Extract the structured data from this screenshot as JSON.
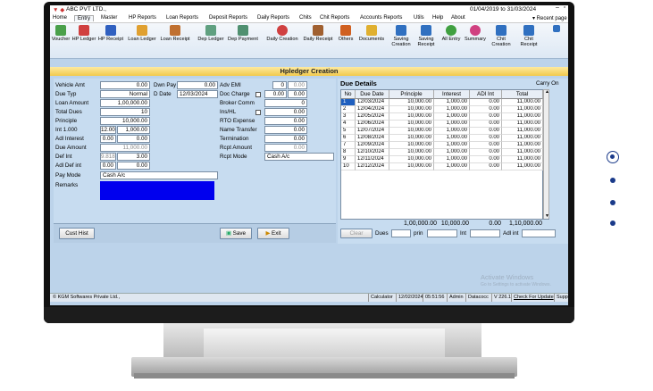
{
  "titlebar": {
    "app": "ABC PVT LTD.,",
    "period": "01/04/2019 to 31/03/2024"
  },
  "menu": [
    "Home",
    "Entry",
    "Master",
    "HP Reports",
    "Loan Reports",
    "Deposit Reports",
    "Daily Reports",
    "Chits",
    "Chit Reports",
    "Accounts Reports",
    "Utils",
    "Help",
    "About"
  ],
  "menu_right": "▾ Recent page",
  "ribbon": [
    {
      "label": "Voucher",
      "color": "#4aa04a"
    },
    {
      "label": "HP Ledger",
      "color": "#d04040"
    },
    {
      "label": "HP Receipt",
      "color": "#3060c0"
    },
    {
      "label": "Loan Ledger",
      "color": "#e0a030"
    },
    {
      "label": "Loan Receipt",
      "color": "#c07030"
    },
    {
      "label": "Dep Ledger",
      "color": "#60a080"
    },
    {
      "label": "Dep Payment",
      "color": "#509070"
    },
    {
      "label": "Daily Creation",
      "color": "#d04040"
    },
    {
      "label": "Daily Receipt",
      "color": "#a06030"
    },
    {
      "label": "Others",
      "color": "#d06020"
    },
    {
      "label": "Documents",
      "color": "#e0b030"
    },
    {
      "label": "Saving Creation",
      "color": "#3070c0"
    },
    {
      "label": "Saving Receipt",
      "color": "#3070c0"
    },
    {
      "label": "All Entry",
      "color": "#40a040"
    },
    {
      "label": "Summary",
      "color": "#d04080"
    },
    {
      "label": "Chit Creation",
      "color": "#3070c0"
    },
    {
      "label": "Chit Receipt",
      "color": "#3070c0"
    }
  ],
  "window_title": "Hpledger Creation",
  "form": {
    "vehicle_amt_label": "Vehicle Amt",
    "vehicle_amt": "0.00",
    "dwn_pay_label": "Dwn Pay",
    "dwn_pay": "0.00",
    "adv_emi_label": "Adv EMI",
    "adv_emi_n": "0",
    "adv_emi": "0.00",
    "due_typ_label": "Due Typ",
    "due_typ": "Normal",
    "d_date_label": "D Date",
    "d_date": "12/03/2024",
    "doc_charge_label": "Doc Charge",
    "doc_charge_pct": "0.00",
    "doc_charge": "0.00",
    "loan_amount_label": "Loan Amount",
    "loan_amount": "1,00,000.00",
    "broker_comm_label": "Broker Comm",
    "broker_comm": "0",
    "total_dues_label": "Total Dues",
    "total_dues": "10",
    "ins_hl_label": "Ins/HL",
    "ins_hl": "0.00",
    "principle_label": "Principle",
    "principle": "10,000.00",
    "rto_label": "RTO Expense",
    "rto": "0.00",
    "int_label": "Int  1.000",
    "int_n": "12.00",
    "int_val": "1,000.00",
    "name_transfer_label": "Name Transfer",
    "name_transfer": "0.00",
    "adl_interest_label": "Adl Interest",
    "adl_interest_a": "0.00",
    "adl_interest_b": "0.00",
    "termination_label": "Termination",
    "termination": "0.00",
    "due_amount_label": "Due Amount",
    "due_amount": "11,000.00",
    "rcpt_amount_label": "Rcpt Amount",
    "rcpt_amount": "0.00",
    "def_int_label": "Def Int",
    "def_int_a": "9.818",
    "def_int_b": "3.00",
    "rcpt_mode_label": "Rcpt Mode",
    "rcpt_mode": "Cash A/c",
    "adl_def_int_label": "Adl Def int",
    "adl_def_int_a": "0.00",
    "adl_def_int_b": "0.00",
    "pay_mode_label": "Pay Mode",
    "pay_mode": "Cash A/c",
    "remarks_label": "Remarks"
  },
  "buttons": {
    "cust_hist": "Cust Hist",
    "save": "Save",
    "exit": "Exit"
  },
  "due": {
    "title": "Due Details",
    "carry_on": "Carry On",
    "headers": [
      "No",
      "Due Date",
      "Principle",
      "Interest",
      "ADl Int",
      "Total"
    ],
    "rows": [
      [
        "1",
        "12/03/2024",
        "10,000.00",
        "1,000.00",
        "0.00",
        "11,000.00"
      ],
      [
        "2",
        "12/04/2024",
        "10,000.00",
        "1,000.00",
        "0.00",
        "11,000.00"
      ],
      [
        "3",
        "12/05/2024",
        "10,000.00",
        "1,000.00",
        "0.00",
        "11,000.00"
      ],
      [
        "4",
        "12/06/2024",
        "10,000.00",
        "1,000.00",
        "0.00",
        "11,000.00"
      ],
      [
        "5",
        "12/07/2024",
        "10,000.00",
        "1,000.00",
        "0.00",
        "11,000.00"
      ],
      [
        "6",
        "12/08/2024",
        "10,000.00",
        "1,000.00",
        "0.00",
        "11,000.00"
      ],
      [
        "7",
        "12/09/2024",
        "10,000.00",
        "1,000.00",
        "0.00",
        "11,000.00"
      ],
      [
        "8",
        "12/10/2024",
        "10,000.00",
        "1,000.00",
        "0.00",
        "11,000.00"
      ],
      [
        "9",
        "12/11/2024",
        "10,000.00",
        "1,000.00",
        "0.00",
        "11,000.00"
      ],
      [
        "10",
        "12/12/2024",
        "10,000.00",
        "1,000.00",
        "0.00",
        "11,000.00"
      ]
    ],
    "totals": [
      "1,00,000.00",
      "10,000.00",
      "0.00",
      "1,10,000.00"
    ],
    "clear": "Clear",
    "dues_label": "Dues",
    "prin_label": "prin",
    "int_label": "Int",
    "adl_int_label": "Adl int"
  },
  "watermark": {
    "line1": "Activate Windows",
    "line2": "Go to Settings to activate Windows."
  },
  "status": {
    "company": "© KGM Softwares Private Ltd.,",
    "calc": "Calculator",
    "date": "12/02/2024",
    "time": "05:51:56",
    "user": "Admin",
    "db": "Datacocc",
    "ver": "V 226.1",
    "check": "Check For Update",
    "supp": "Supp"
  }
}
